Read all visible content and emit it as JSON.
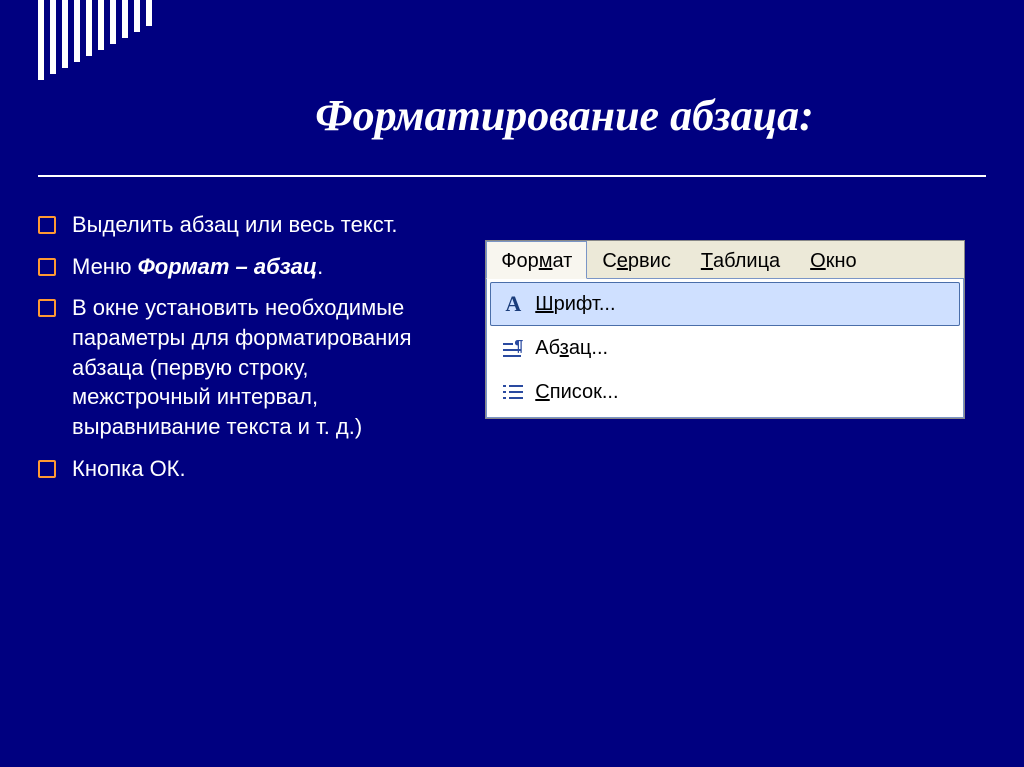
{
  "title": "Форматирование абзаца:",
  "bullets": [
    {
      "pre": "Выделить абзац или весь текст.",
      "bold": "",
      "post": ""
    },
    {
      "pre": "Меню ",
      "bold": "Формат – абзац",
      "post": "."
    },
    {
      "pre": "В окне установить необходимые параметры для форматирования абзаца (первую строку, межстрочный интервал, выравнивание текста и т. д.)",
      "bold": "",
      "post": ""
    },
    {
      "pre": "Кнопка ОК.",
      "bold": "",
      "post": ""
    }
  ],
  "menubar": {
    "items": [
      {
        "pre": "Фор",
        "u": "м",
        "post": "ат"
      },
      {
        "pre": "С",
        "u": "е",
        "post": "рвис"
      },
      {
        "pre": "",
        "u": "Т",
        "post": "аблица"
      },
      {
        "pre": "",
        "u": "О",
        "post": "кно"
      }
    ]
  },
  "dropdown": {
    "items": [
      {
        "pre": "",
        "u": "Ш",
        "post": "рифт...",
        "hover": true,
        "icon": "font"
      },
      {
        "pre": "Аб",
        "u": "з",
        "post": "ац...",
        "hover": false,
        "icon": "para"
      },
      {
        "pre": "",
        "u": "С",
        "post": "писок...",
        "hover": false,
        "icon": "list"
      }
    ]
  }
}
